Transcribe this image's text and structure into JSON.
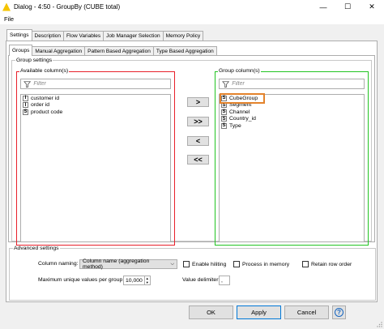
{
  "window": {
    "title": "Dialog - 4:50 - GroupBy (CUBE total)",
    "minimize_glyph": "—",
    "maximize_glyph": "☐",
    "close_glyph": "✕"
  },
  "menu": {
    "file": "File"
  },
  "outer_tabs": [
    "Settings",
    "Description",
    "Flow Variables",
    "Job Manager Selection",
    "Memory Policy"
  ],
  "inner_tabs": [
    "Groups",
    "Manual Aggregation",
    "Pattern Based Aggregation",
    "Type Based Aggregation"
  ],
  "group_settings": {
    "legend": "Group settings",
    "available": {
      "title": "Available column(s)",
      "filter_placeholder": "Filter",
      "items": [
        {
          "type": "I",
          "name": "customer id"
        },
        {
          "type": "I",
          "name": "order id"
        },
        {
          "type": "S",
          "name": "product code"
        }
      ]
    },
    "group": {
      "title": "Group column(s)",
      "filter_placeholder": "Filter",
      "items": [
        {
          "type": "S",
          "name": "CubeGroup"
        },
        {
          "type": "S",
          "name": "Segment"
        },
        {
          "type": "S",
          "name": "Channel"
        },
        {
          "type": "S",
          "name": "Country_id"
        },
        {
          "type": "S",
          "name": "Type"
        }
      ]
    },
    "buttons": {
      "add": ">",
      "add_all": ">>",
      "remove": "<",
      "remove_all": "<<"
    }
  },
  "advanced": {
    "legend": "Advanced settings",
    "column_naming_label": "Column naming:",
    "column_naming_value": "Column name (aggregation method)",
    "enable_hiliting": "Enable hiliting",
    "process_in_memory": "Process in memory",
    "retain_row_order": "Retain row order",
    "max_unique_label": "Maximum unique values per group",
    "max_unique_value": "10,000",
    "value_delimiter_label": "Value delimiter",
    "value_delimiter_value": ","
  },
  "footer": {
    "ok": "OK",
    "apply": "Apply",
    "cancel": "Cancel",
    "help": "?"
  },
  "colors": {
    "available_border": "#e8202a",
    "group_border": "#22c422",
    "highlight": "#e3832c",
    "help_icon": "#1565c0"
  }
}
